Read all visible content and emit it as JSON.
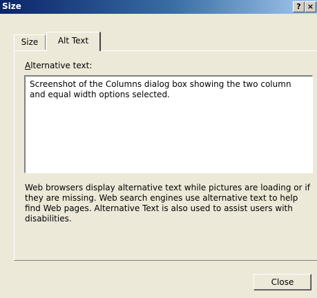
{
  "window": {
    "title": "Size",
    "help_button": "?",
    "close_button": "×"
  },
  "tabs": [
    {
      "label": "Size",
      "active": false
    },
    {
      "label": "Alt Text",
      "active": true
    }
  ],
  "alt_text": {
    "label_accel": "A",
    "label_rest": "lternative text:",
    "value": "Screenshot of the Columns dialog box showing the two column\nand equal width options selected."
  },
  "help_text": "Web browsers display alternative text while pictures are loading or if they are missing.  Web search engines use alternative text to help find Web pages.  Alternative Text is also used to assist users with disabilities.",
  "buttons": {
    "close_label": "Close"
  },
  "colors": {
    "titlebar_start": "#0a246a",
    "titlebar_end": "#a6caf0",
    "dialog_face": "#ece9d8"
  }
}
